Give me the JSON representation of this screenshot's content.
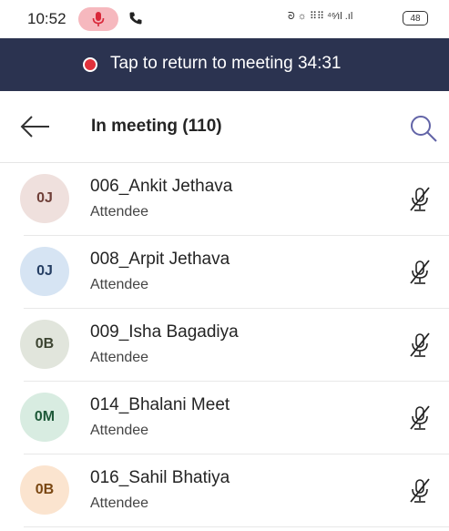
{
  "status_bar": {
    "time": "10:52",
    "icons_right": "ᘐ ☼ ⠿⠿ ⁴⁶⁄ıl .ıl",
    "battery": "48",
    "mic_icon": "microphone-icon",
    "phone_icon": "phone-icon",
    "mic_pill_color": "#f6b8be"
  },
  "banner": {
    "text": "Tap to return to meeting 34:31",
    "background": "#2b3350",
    "dot_color": "#e0313b"
  },
  "header": {
    "title": "In meeting (110)",
    "back_icon": "arrow-left-icon",
    "search_icon": "search-icon",
    "accent": "#6264a7"
  },
  "participants": [
    {
      "initials": "0J",
      "name": "006_Ankit Jethava",
      "role": "Attendee",
      "avatar_bg": "#efe0dd",
      "avatar_fg": "#6f3f38",
      "muted": true
    },
    {
      "initials": "0J",
      "name": "008_Arpit Jethava",
      "role": "Attendee",
      "avatar_bg": "#d6e4f3",
      "avatar_fg": "#253e63",
      "muted": true
    },
    {
      "initials": "0B",
      "name": "009_Isha Bagadiya",
      "role": "Attendee",
      "avatar_bg": "#e1e5dc",
      "avatar_fg": "#3d4532",
      "muted": true
    },
    {
      "initials": "0M",
      "name": "014_Bhalani Meet",
      "role": "Attendee",
      "avatar_bg": "#d8ece1",
      "avatar_fg": "#1f5a3a",
      "muted": true
    },
    {
      "initials": "0B",
      "name": "016_Sahil Bhatiya",
      "role": "Attendee",
      "avatar_bg": "#fbe4cf",
      "avatar_fg": "#7a4712",
      "muted": true
    }
  ]
}
